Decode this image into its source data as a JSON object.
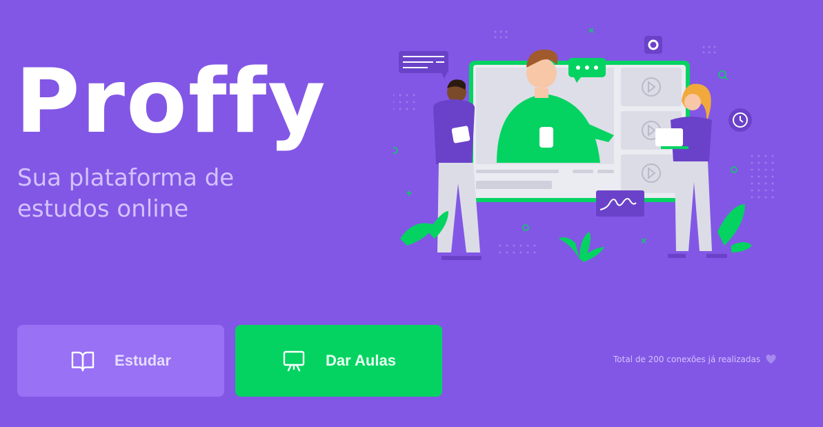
{
  "brand": {
    "logo_text": "Proffy",
    "tagline": "Sua plataforma de estudos online"
  },
  "actions": {
    "study_label": "Estudar",
    "give_classes_label": "Dar Aulas"
  },
  "footer": {
    "connections_text": "Total de 200 conexões já realizadas"
  },
  "icons": {
    "study": "book-open-icon",
    "give_classes": "presentation-board-icon",
    "heart": "heart-icon"
  },
  "colors": {
    "background": "#8257e5",
    "study_button": "#9871f5",
    "give_classes_button": "#04d361",
    "text_light": "#d4c2ff"
  }
}
